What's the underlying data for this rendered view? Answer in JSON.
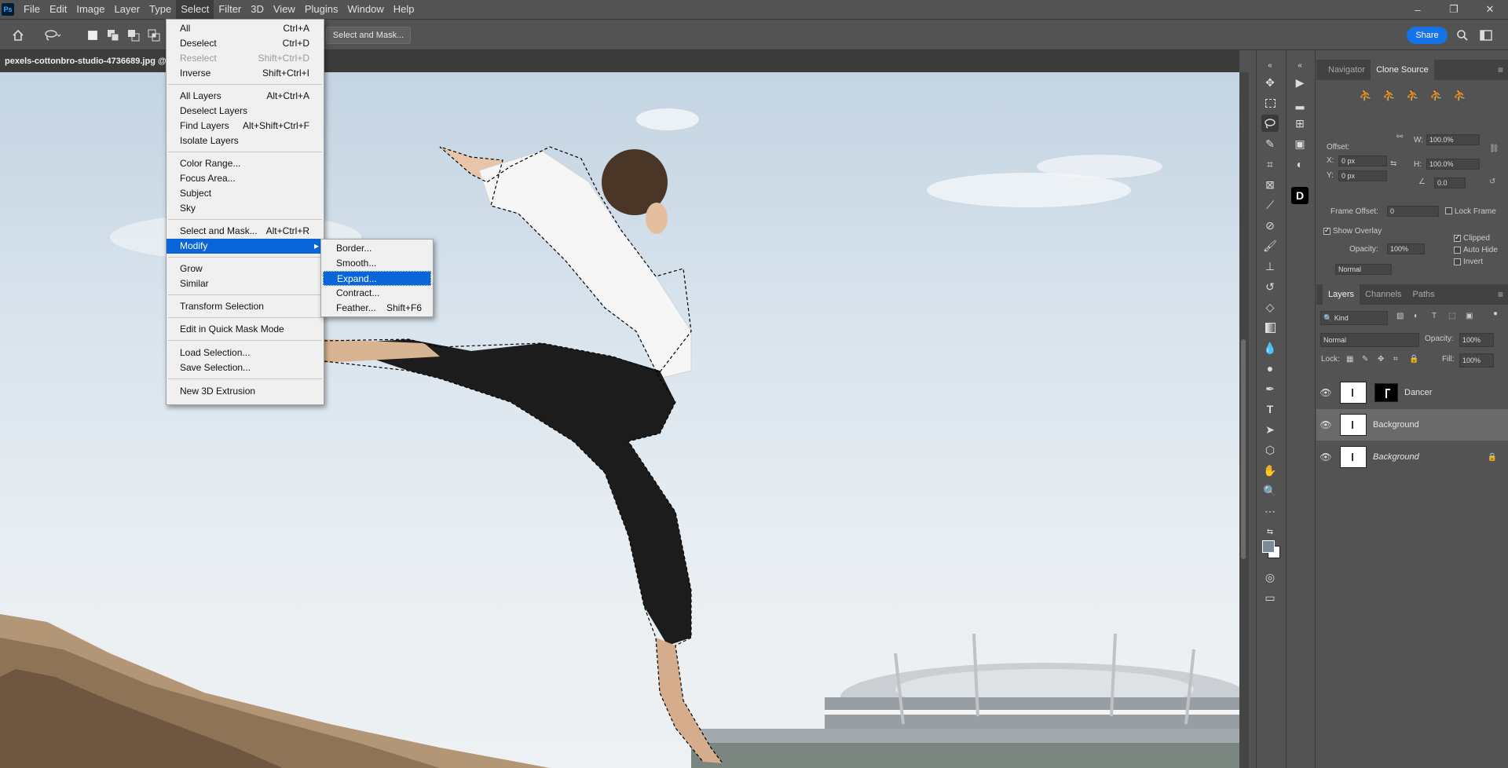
{
  "app": {
    "logo": "Ps"
  },
  "menubar": [
    "File",
    "Edit",
    "Image",
    "Layer",
    "Type",
    "Select",
    "Filter",
    "3D",
    "View",
    "Plugins",
    "Window",
    "Help"
  ],
  "window_controls": {
    "minimize": "–",
    "restore": "❐",
    "close": "✕"
  },
  "options": {
    "select_mask_label": "Select and Mask...",
    "share_label": "Share"
  },
  "document": {
    "tab_title": "pexels-cottonbro-studio-4736689.jpg @"
  },
  "select_menu": [
    {
      "label": "All",
      "shortcut": "Ctrl+A"
    },
    {
      "label": "Deselect",
      "shortcut": "Ctrl+D"
    },
    {
      "label": "Reselect",
      "shortcut": "Shift+Ctrl+D",
      "disabled": true
    },
    {
      "label": "Inverse",
      "shortcut": "Shift+Ctrl+I"
    },
    {
      "label": "All Layers",
      "shortcut": "Alt+Ctrl+A"
    },
    {
      "label": "Deselect Layers",
      "shortcut": ""
    },
    {
      "label": "Find Layers",
      "shortcut": "Alt+Shift+Ctrl+F"
    },
    {
      "label": "Isolate Layers",
      "shortcut": ""
    },
    {
      "label": "Color Range...",
      "shortcut": ""
    },
    {
      "label": "Focus Area...",
      "shortcut": ""
    },
    {
      "label": "Subject",
      "shortcut": ""
    },
    {
      "label": "Sky",
      "shortcut": ""
    },
    {
      "label": "Select and Mask...",
      "shortcut": "Alt+Ctrl+R"
    },
    {
      "label": "Modify",
      "shortcut": "▸"
    },
    {
      "label": "Grow",
      "shortcut": ""
    },
    {
      "label": "Similar",
      "shortcut": ""
    },
    {
      "label": "Transform Selection",
      "shortcut": ""
    },
    {
      "label": "Edit in Quick Mask Mode",
      "shortcut": ""
    },
    {
      "label": "Load Selection...",
      "shortcut": ""
    },
    {
      "label": "Save Selection...",
      "shortcut": ""
    },
    {
      "label": "New 3D Extrusion",
      "shortcut": ""
    }
  ],
  "modify_submenu": [
    {
      "label": "Border...",
      "shortcut": ""
    },
    {
      "label": "Smooth...",
      "shortcut": ""
    },
    {
      "label": "Expand...",
      "shortcut": ""
    },
    {
      "label": "Contract...",
      "shortcut": ""
    },
    {
      "label": "Feather...",
      "shortcut": "Shift+F6"
    }
  ],
  "clone_source": {
    "tabs": [
      "Navigator",
      "Clone Source"
    ],
    "offset_label": "Offset:",
    "x_label": "X:",
    "x_value": "0 px",
    "y_label": "Y:",
    "y_value": "0 px",
    "w_label": "W:",
    "w_value": "100.0%",
    "h_label": "H:",
    "h_value": "100.0%",
    "angle_value": "0.0",
    "frame_offset_label": "Frame Offset:",
    "frame_offset_value": "0",
    "lock_frame": "Lock Frame",
    "show_overlay": "Show Overlay",
    "opacity_label": "Opacity:",
    "opacity_value": "100%",
    "blend_value": "Normal",
    "clipped": "Clipped",
    "auto_hide": "Auto Hide",
    "invert": "Invert"
  },
  "layers_panel": {
    "tabs": [
      "Layers",
      "Channels",
      "Paths"
    ],
    "filter_label": "Kind",
    "blend_mode": "Normal",
    "opacity_label": "Opacity:",
    "opacity_value": "100%",
    "lock_label": "Lock:",
    "fill_label": "Fill:",
    "fill_value": "100%",
    "layers": [
      {
        "name": "Dancer"
      },
      {
        "name": "Background"
      },
      {
        "name": "Background"
      }
    ]
  }
}
